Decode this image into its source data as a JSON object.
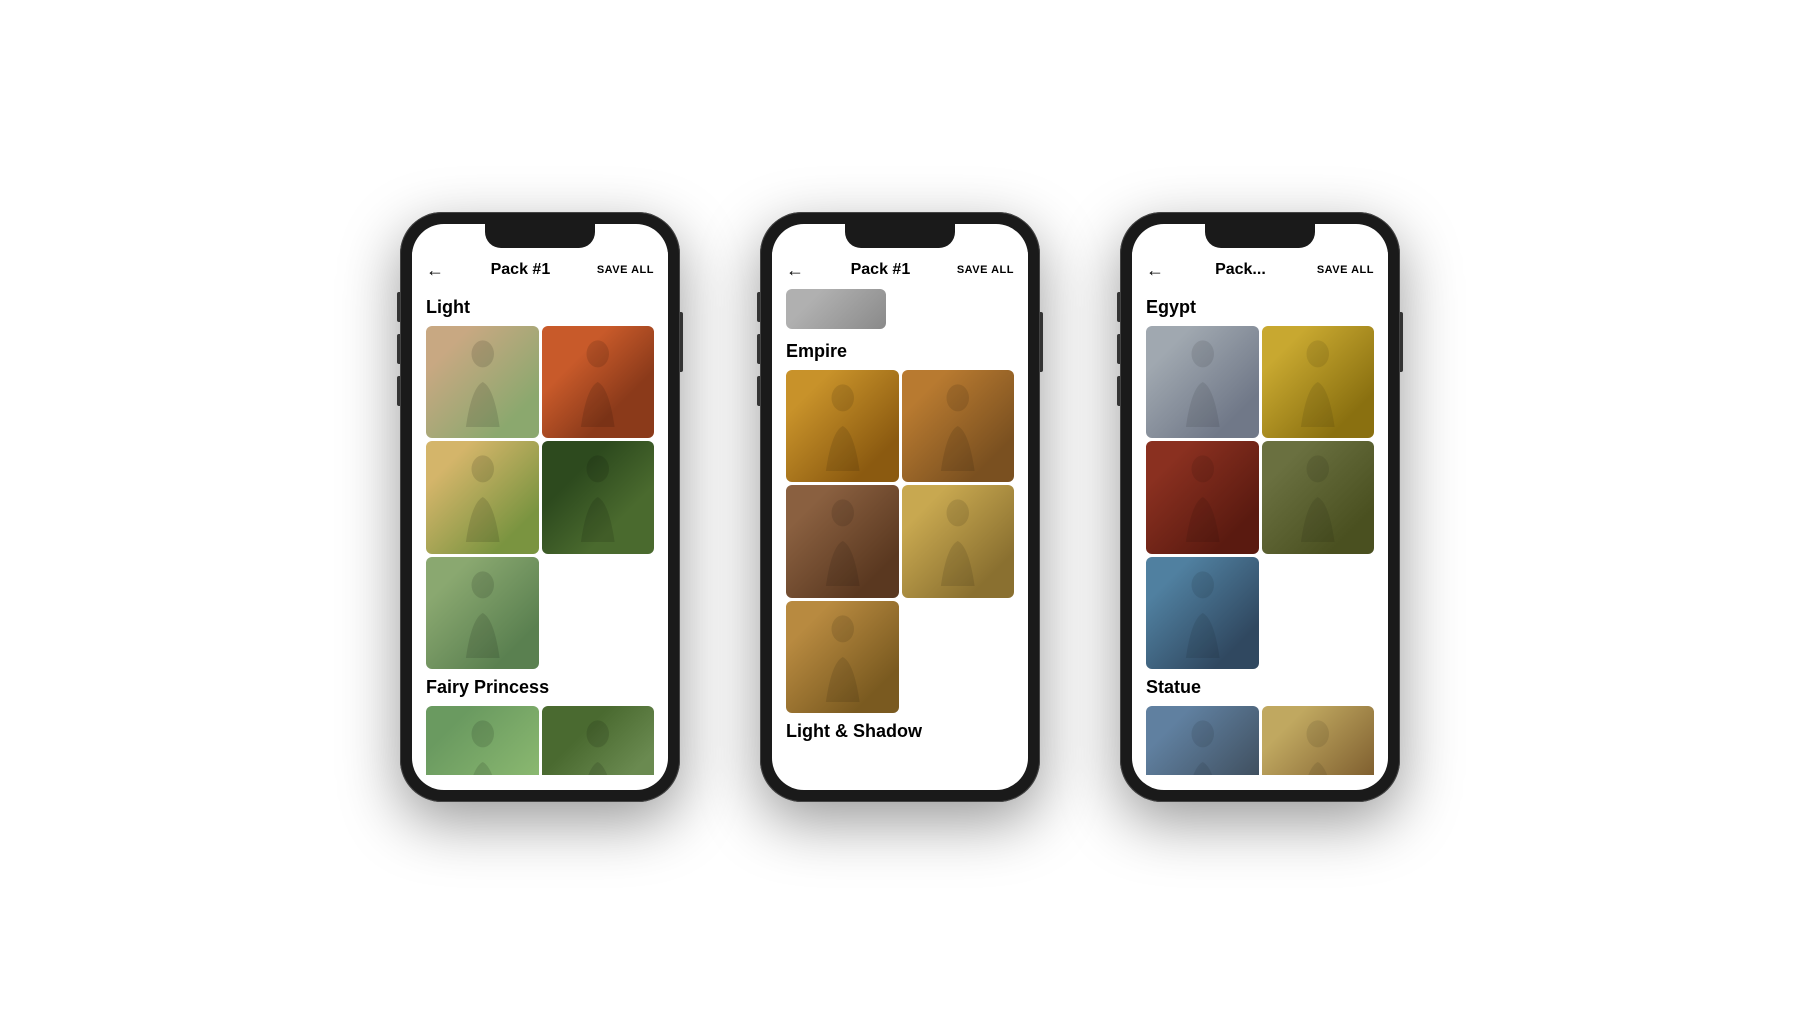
{
  "page": {
    "background": "#ffffff"
  },
  "phones": [
    {
      "id": "phone1",
      "header": {
        "back_label": "←",
        "title": "Pack #1",
        "save_all_label": "SAVE ALL"
      },
      "sections": [
        {
          "title": "Light",
          "images": [
            {
              "id": "p1-img1",
              "alt": "Woman in garden painting"
            },
            {
              "id": "p1-img2",
              "alt": "Woman portrait painting"
            },
            {
              "id": "p1-img3",
              "alt": "Woman in meadow painting"
            },
            {
              "id": "p1-img4",
              "alt": "Woman in forest painting"
            },
            {
              "id": "p1-img5",
              "alt": "Woman seated painting",
              "single": true
            }
          ]
        },
        {
          "title": "Fairy Princess",
          "images": [
            {
              "id": "p1-fp1",
              "alt": "Fairy princess forest 1"
            },
            {
              "id": "p1-fp2",
              "alt": "Fairy princess forest 2"
            }
          ]
        }
      ]
    },
    {
      "id": "phone2",
      "header": {
        "back_label": "←",
        "title": "Pack #1",
        "save_all_label": "SAVE ALL"
      },
      "sections": [
        {
          "title": "",
          "images": [
            {
              "id": "p2-img-top",
              "alt": "Top partial image",
              "full_top": true
            }
          ]
        },
        {
          "title": "Empire",
          "images": [
            {
              "id": "p2-emp1",
              "alt": "Empire portrait 1"
            },
            {
              "id": "p2-emp2",
              "alt": "Empire portrait 2"
            },
            {
              "id": "p2-emp3",
              "alt": "Empire portrait 3"
            },
            {
              "id": "p2-emp4",
              "alt": "Empire portrait 4"
            },
            {
              "id": "p2-emp5",
              "alt": "Empire portrait 5",
              "single": true
            }
          ]
        },
        {
          "title": "Light & Shadow",
          "images": []
        }
      ]
    },
    {
      "id": "phone3",
      "header": {
        "back_label": "←",
        "title": "Pack...",
        "save_all_label": "SAVE ALL"
      },
      "sections": [
        {
          "title": "Egypt",
          "images": [
            {
              "id": "p3-egy1",
              "alt": "Egypt portrait 1"
            },
            {
              "id": "p3-egy2",
              "alt": "Egypt portrait 2"
            },
            {
              "id": "p3-egy3",
              "alt": "Egypt portrait 3"
            },
            {
              "id": "p3-egy4",
              "alt": "Egypt portrait 4"
            },
            {
              "id": "p3-egy5",
              "alt": "Egypt portrait 5",
              "single": true
            }
          ]
        },
        {
          "title": "Statue",
          "images": [
            {
              "id": "p3-stat1",
              "alt": "Statue portrait 1"
            },
            {
              "id": "p3-stat2",
              "alt": "Statue portrait 2"
            }
          ]
        }
      ]
    }
  ]
}
